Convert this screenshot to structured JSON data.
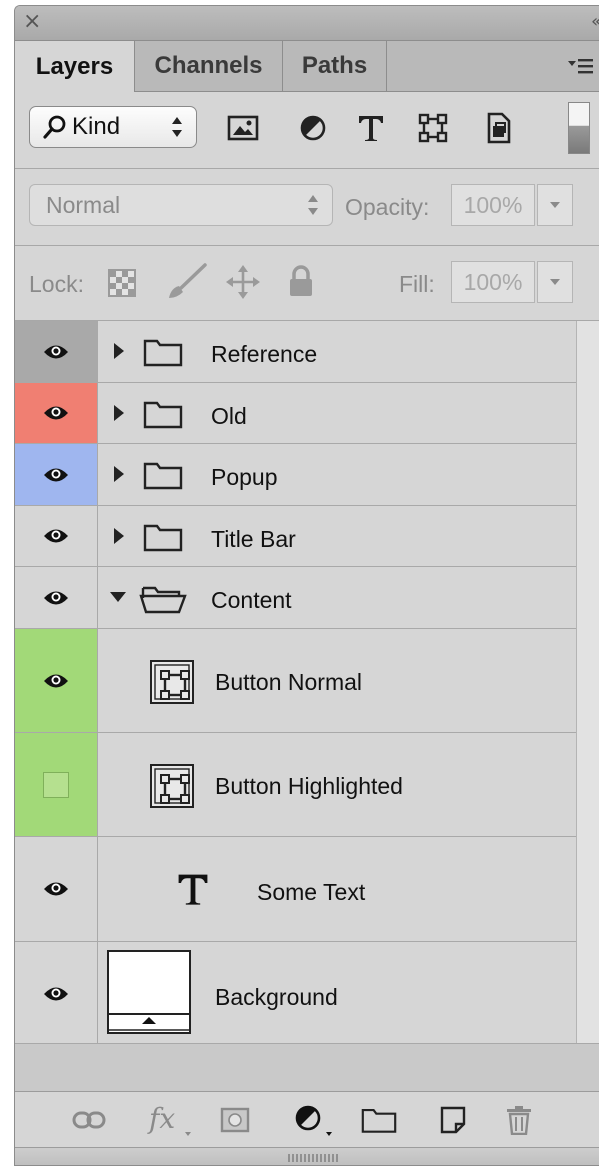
{
  "panel": {
    "close_glyph": "×",
    "collapse_glyph": "«"
  },
  "tabs": [
    {
      "label": "Layers",
      "active": true
    },
    {
      "label": "Channels",
      "active": false
    },
    {
      "label": "Paths",
      "active": false
    }
  ],
  "filter": {
    "kind_label": "Kind",
    "icons": [
      "pixel-layer-filter-icon",
      "adjustment-layer-filter-icon",
      "type-layer-filter-icon",
      "shape-layer-filter-icon",
      "smart-object-filter-icon"
    ]
  },
  "blend": {
    "mode": "Normal",
    "opacity_label": "Opacity:",
    "opacity_value": "100%"
  },
  "lock": {
    "label": "Lock:",
    "fill_label": "Fill:",
    "fill_value": "100%"
  },
  "layers": [
    {
      "name": "Reference",
      "kind": "group",
      "expanded": false,
      "visible": true,
      "color": "#a9a9a9"
    },
    {
      "name": "Old",
      "kind": "group",
      "expanded": false,
      "visible": true,
      "color": "#f07f72"
    },
    {
      "name": "Popup",
      "kind": "group",
      "expanded": false,
      "visible": true,
      "color": "#9fb6ef"
    },
    {
      "name": "Title Bar",
      "kind": "group",
      "expanded": false,
      "visible": true,
      "color": ""
    },
    {
      "name": "Content",
      "kind": "group",
      "expanded": true,
      "visible": true,
      "color": ""
    },
    {
      "name": "Button Normal",
      "kind": "shape",
      "visible": true,
      "color": "#a2d978"
    },
    {
      "name": "Button Highlighted",
      "kind": "shape",
      "visible": false,
      "color": "#a2d978"
    },
    {
      "name": "Some Text",
      "kind": "type",
      "visible": true,
      "color": ""
    },
    {
      "name": "Background",
      "kind": "pixel",
      "visible": true,
      "color": ""
    }
  ],
  "bottom_icons": [
    "link-layers-icon",
    "fx-icon",
    "add-mask-icon",
    "new-adjustment-icon",
    "new-group-icon",
    "new-layer-icon",
    "delete-layer-icon"
  ],
  "colors": {
    "panel_bg": "#d6d6d6",
    "tab_bar": "#b9b9b9"
  }
}
